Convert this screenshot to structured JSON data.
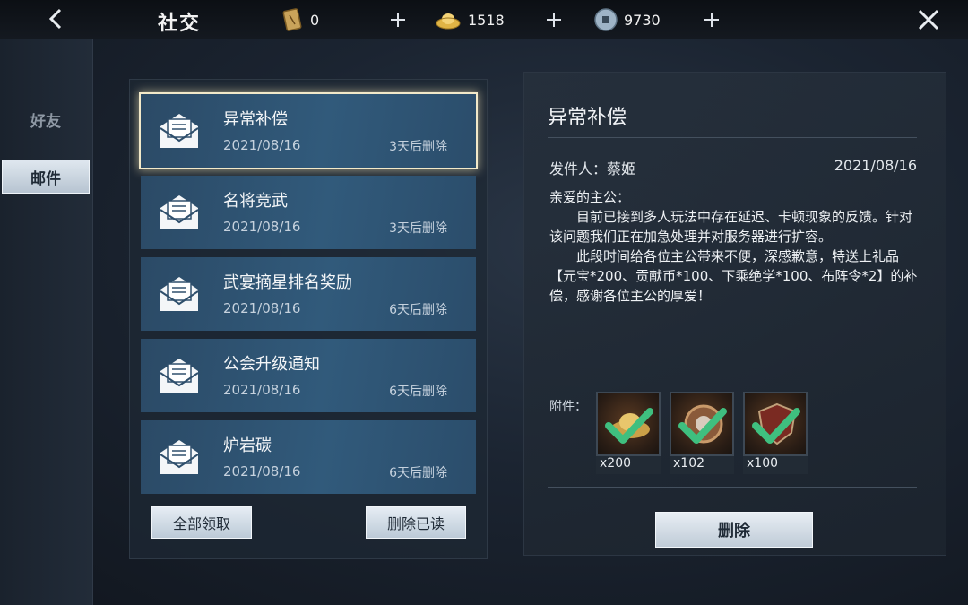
{
  "header": {
    "title": "社交",
    "currencies": [
      {
        "icon": "token-icon",
        "value": "0"
      },
      {
        "icon": "gold-ingot-icon",
        "value": "1518"
      },
      {
        "icon": "coin-icon",
        "value": "9730"
      }
    ]
  },
  "nav": {
    "friends": "好友",
    "mail": "邮件",
    "active": "mail"
  },
  "mail_list": {
    "items": [
      {
        "subject": "异常补偿",
        "date": "2021/08/16",
        "expire": "3天后删除",
        "selected": true
      },
      {
        "subject": "名将竞武",
        "date": "2021/08/16",
        "expire": "3天后删除",
        "selected": false
      },
      {
        "subject": "武宴摘星排名奖励",
        "date": "2021/08/16",
        "expire": "6天后删除",
        "selected": false
      },
      {
        "subject": "公会升级通知",
        "date": "2021/08/16",
        "expire": "6天后删除",
        "selected": false
      },
      {
        "subject": "炉岩碳",
        "date": "2021/08/16",
        "expire": "6天后删除",
        "selected": false
      }
    ],
    "claim_all_label": "全部领取",
    "delete_read_label": "删除已读"
  },
  "detail": {
    "title": "异常补偿",
    "sender_label": "发件人：蔡姬",
    "date": "2021/08/16",
    "greeting": "亲爱的主公：",
    "paragraph1": "目前已接到多人玩法中存在延迟、卡顿现象的反馈。针对该问题我们正在加急处理并对服务器进行扩容。",
    "paragraph2": "此段时间给各位主公带来不便，深感歉意，特送上礼品【元宝*200、贡献币*100、下乘绝学*100、布阵令*2】的补偿，感谢各位主公的厚爱！",
    "attachments_label": "附件：",
    "attachments": [
      {
        "icon": "gold-ingot-item-icon",
        "count": "x200",
        "claimed": true
      },
      {
        "icon": "contribution-coin-item-icon",
        "count": "x102",
        "claimed": true
      },
      {
        "icon": "shield-item-icon",
        "count": "x100",
        "claimed": true
      }
    ],
    "delete_label": "删除"
  },
  "colors": {
    "accent_check": "#3fbf7f",
    "selected_glow": "#f2e9c9",
    "button_bg": "#dfe7ef"
  }
}
